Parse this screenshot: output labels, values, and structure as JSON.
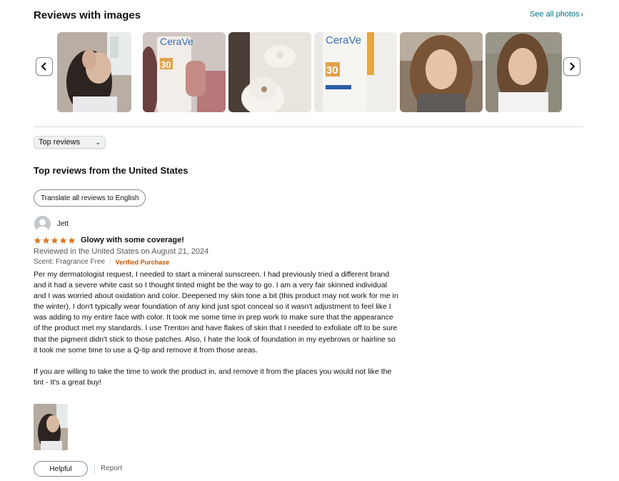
{
  "reviews_images": {
    "title": "Reviews with images",
    "see_all": "See all photos",
    "thumbnails": [
      {
        "icon": "selfie-photo"
      },
      {
        "icon": "cerave-bottle-photo",
        "brand_text": "CeraVe",
        "spf_text": "30"
      },
      {
        "icon": "cap-closeup-photo"
      },
      {
        "icon": "cerave-bottle-photo",
        "brand_text": "CeraVe",
        "spf_text": "30"
      },
      {
        "icon": "face-photo"
      },
      {
        "icon": "face-photo"
      }
    ]
  },
  "sort": {
    "selected": "Top reviews"
  },
  "top_reviews": {
    "title": "Top reviews from the United States",
    "translate_label": "Translate all reviews to English"
  },
  "review": {
    "author": "Jett",
    "rating": 5,
    "title": "Glowy with some coverage!",
    "meta": "Reviewed in the United States on August 21, 2024",
    "scent": "Scent: Fragrance Free",
    "verified": "Verified Purchase",
    "body_p1": "Per my dermatologist request, I needed to start a mineral sunscreen. I had previously tried a different brand and it had a severe white cast so I thought tinted might be the way to go. I am a very fair skinned individual and I was worried about oxidation and color. Deepened my skin tone a bit (this product may not work for me in the winter), I don't typically wear foundation of any kind just spot conceal so it wasn't adjustment to feel like I was adding to my entire face with color. It took me some time in prep work to make sure that the appearance of the product met my standards. I use Trenton and have flakes of skin that I needed to exfoliate off to be sure that the pigment didn't stick to those patches. Also, I hate the look of foundation in my eyebrows or hairline so it took me some time to use a Q-tip and remove it from those areas.",
    "body_p2": "If you are willing to take the time to work the product in, and remove it from the places you would not like the tint - It's a great buy!",
    "helpful_label": "Helpful",
    "report_label": "Report"
  },
  "colors": {
    "star": "#de7921",
    "link": "#007185",
    "verified": "#c45500"
  }
}
